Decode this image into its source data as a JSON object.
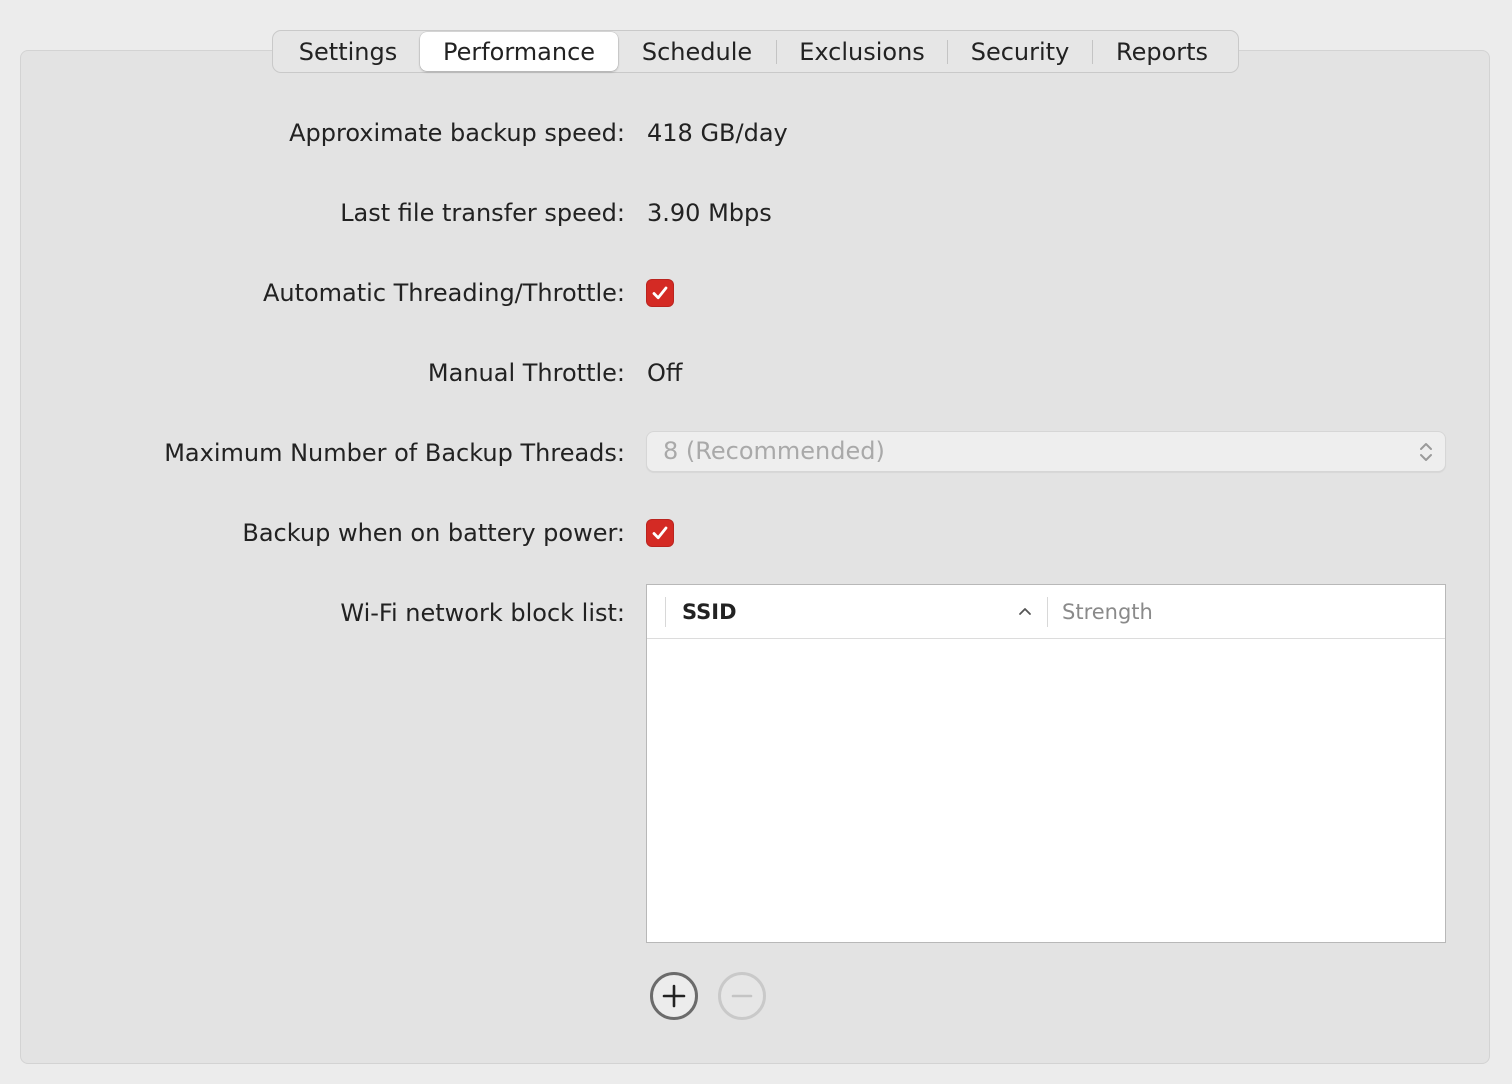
{
  "tabs": [
    {
      "label": "Settings",
      "active": false
    },
    {
      "label": "Performance",
      "active": true
    },
    {
      "label": "Schedule",
      "active": false
    },
    {
      "label": "Exclusions",
      "active": false
    },
    {
      "label": "Security",
      "active": false
    },
    {
      "label": "Reports",
      "active": false
    }
  ],
  "rows": {
    "backup_speed": {
      "label": "Approximate backup speed:",
      "value": "418 GB/day"
    },
    "transfer_speed": {
      "label": "Last file transfer speed:",
      "value": "3.90 Mbps"
    },
    "auto_throttle": {
      "label": "Automatic Threading/Throttle:",
      "checked": true
    },
    "manual_throttle": {
      "label": "Manual Throttle:",
      "value": "Off"
    },
    "max_threads": {
      "label": "Maximum Number of Backup Threads:",
      "selected": "8 (Recommended)",
      "disabled": true
    },
    "battery": {
      "label": "Backup when on battery power:",
      "checked": true
    },
    "wifi_block": {
      "label": "Wi-Fi network block list:"
    }
  },
  "wifi_table": {
    "columns": [
      "SSID",
      "Strength"
    ],
    "sort_column": "SSID",
    "sort_direction": "ascending",
    "rows": []
  },
  "colors": {
    "checkbox_accent": "#d42a24",
    "panel_bg": "#e3e3e3",
    "window_bg": "#ececec"
  },
  "icons": {
    "add": "plus-circle-icon",
    "remove": "minus-circle-icon",
    "sort": "chevron-up-icon",
    "select": "up-down-chevron-icon",
    "check": "checkmark-icon"
  }
}
